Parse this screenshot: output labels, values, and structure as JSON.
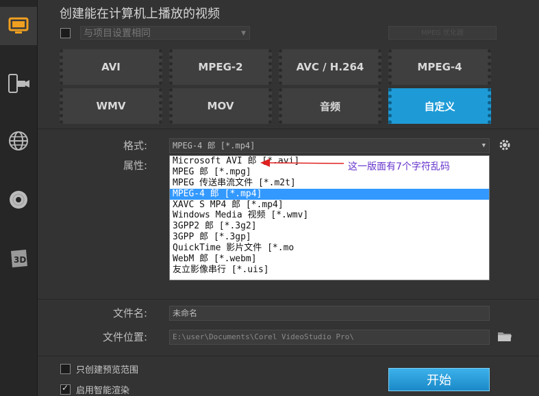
{
  "title": "创建能在计算机上播放的视频",
  "preset": {
    "value": "与项目设置相同",
    "checked": false
  },
  "options_button": "MPEG 优化器",
  "formats": [
    "AVI",
    "MPEG-2",
    "AVC / H.264",
    "MPEG-4",
    "WMV",
    "MOV",
    "音频",
    "自定义"
  ],
  "selected_format": "自定义",
  "format_label": "格式:",
  "format_value": "MPEG-4 郎 [*.mp4]",
  "properties_label": "属性:",
  "dropdown": [
    "Microsoft AVI 郎 [*.avi]",
    "MPEG 郎 [*.mpg]",
    "MPEG 传送串流文件 [*.m2t]",
    "MPEG-4 郎 [*.mp4]",
    "XAVC S MP4 郎 [*.mp4]",
    "Windows Media 视频 [*.wmv]",
    "3GPP2 郎 [*.3g2]",
    "3GPP 郎 [*.3gp]",
    "QuickTime 影片文件 [*.mo",
    "WebM 郎 [*.webm]",
    "友立影像串行 [*.uis]"
  ],
  "dropdown_selected_index": 3,
  "annotation": "这一版面有7个字符乱码",
  "filename_label": "文件名:",
  "filename_value": "未命名",
  "location_label": "文件位置:",
  "location_value": "E:\\user\\Documents\\Corel VideoStudio Pro\\",
  "preview_range": {
    "label": "只创建预览范围",
    "checked": false
  },
  "smart_render": {
    "label": "启用智能渲染",
    "checked": true
  },
  "start_button": "开始"
}
